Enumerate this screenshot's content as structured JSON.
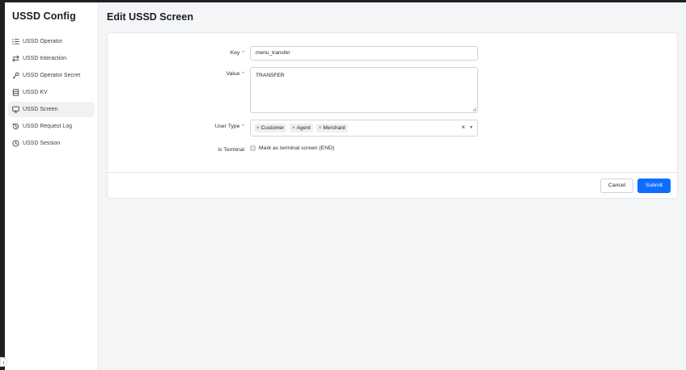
{
  "app": {
    "title": "USSD Config"
  },
  "sidebar": {
    "items": [
      {
        "label": "USSD Operator",
        "icon": "list-icon"
      },
      {
        "label": "USSD Interaction",
        "icon": "arrows-exchange-icon"
      },
      {
        "label": "USSD Operator Secret",
        "icon": "key-icon"
      },
      {
        "label": "USSD KV",
        "icon": "database-icon"
      },
      {
        "label": "USSD Screen",
        "icon": "monitor-icon",
        "active": true
      },
      {
        "label": "USSD Request Log",
        "icon": "history-icon"
      },
      {
        "label": "USSD Session",
        "icon": "clock-icon"
      }
    ],
    "collapse_glyph": "‹"
  },
  "page": {
    "title": "Edit USSD Screen"
  },
  "form": {
    "key": {
      "label": "Key",
      "required_mark": "*",
      "value": "menu_transfer"
    },
    "value": {
      "label": "Value",
      "required_mark": "*",
      "value": "TRANSFER"
    },
    "user_type": {
      "label": "User Type",
      "required_mark": "*",
      "selected": [
        "Customer",
        "Agent",
        "Merchant"
      ],
      "clear_glyph": "×",
      "caret_glyph": "▼",
      "tag_remove_glyph": "×"
    },
    "is_terminal": {
      "label": "Is Terminal",
      "checkbox_label": "Mark as terminal screen (END)",
      "checked": false
    }
  },
  "footer": {
    "cancel_label": "Cancel",
    "submit_label": "Submit"
  },
  "colors": {
    "primary": "#0d6efd",
    "background": "#f4f5f7",
    "sidebar_bg": "#ffffff",
    "required": "#e04848"
  }
}
